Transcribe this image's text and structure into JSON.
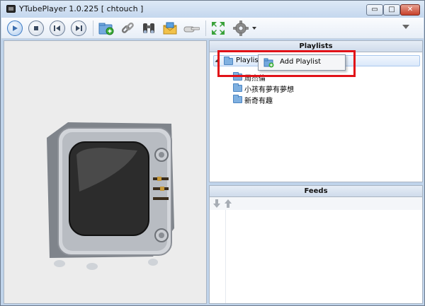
{
  "window": {
    "title": "YTubePlayer 1.0.225 [ chtouch ]",
    "controls": {
      "minimize": "▭",
      "maximize": "□",
      "close": "✕"
    }
  },
  "toolbar": {
    "buttons": [
      {
        "name": "play-button",
        "icon": "play-icon"
      },
      {
        "name": "stop-button",
        "icon": "stop-icon"
      },
      {
        "name": "previous-button",
        "icon": "previous-icon"
      },
      {
        "name": "next-button",
        "icon": "next-icon"
      },
      {
        "name": "add-folder-button",
        "icon": "folder-add-icon"
      },
      {
        "name": "link-button",
        "icon": "link-icon"
      },
      {
        "name": "search-button",
        "icon": "binoculars-icon"
      },
      {
        "name": "mail-button",
        "icon": "envelope-icon"
      },
      {
        "name": "share-button",
        "icon": "hand-pointing-icon"
      },
      {
        "name": "fullscreen-button",
        "icon": "expand-arrows-icon"
      },
      {
        "name": "settings-button",
        "icon": "gear-icon"
      }
    ]
  },
  "playlists": {
    "header": "Playlists",
    "root_label": "Playlists",
    "children": [
      "周杰倫",
      "小孩有夢有夢想",
      "新奇有趣"
    ]
  },
  "context_menu": {
    "items": [
      {
        "label": "Add Playlist",
        "icon": "add-playlist-icon"
      }
    ]
  },
  "feeds": {
    "header": "Feeds"
  },
  "colors": {
    "window_frame": "#bfd3ea",
    "panel_header": "#d6e1ef",
    "highlight_box": "#e11218",
    "folder": "#7fb0e0"
  }
}
